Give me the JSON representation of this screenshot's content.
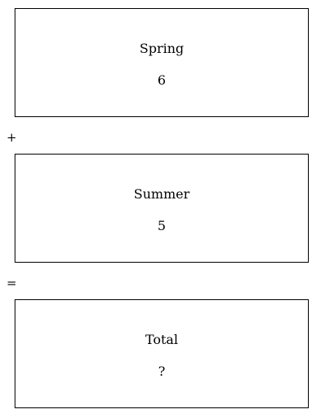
{
  "boxes": {
    "spring": {
      "label": "Spring",
      "value": "6"
    },
    "summer": {
      "label": "Summer",
      "value": "5"
    },
    "total": {
      "label": "Total",
      "value": "?"
    }
  },
  "operators": {
    "plus": "+",
    "equals": "="
  }
}
